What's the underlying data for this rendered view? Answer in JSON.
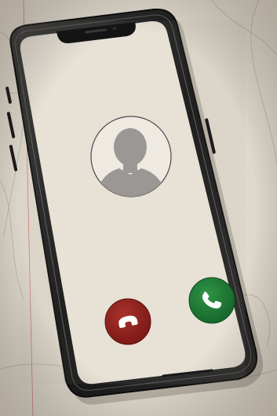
{
  "scene": {
    "description_icons": {
      "avatar": "person-silhouette-icon",
      "decline": "phone-hangup-icon",
      "accept": "phone-icon"
    },
    "colors": {
      "paper": "#e4ddd0",
      "screen": "#ece6da",
      "frame": "#1e1e1e",
      "decline": "#8e1f1c",
      "accept": "#1c7a33",
      "silhouette": "#9a9794",
      "sketch_line": "#b0a89a",
      "red_line": "#c0413a"
    }
  }
}
